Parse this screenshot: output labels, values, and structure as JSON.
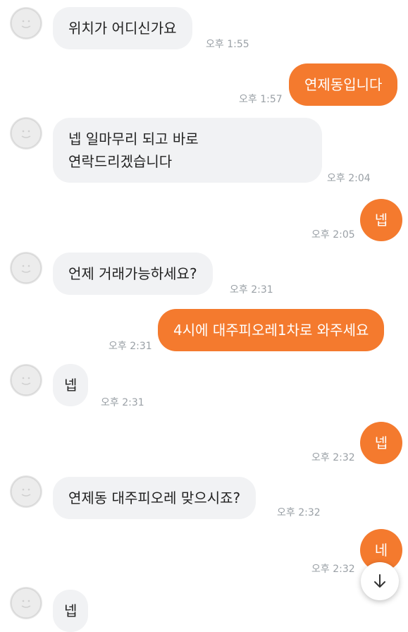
{
  "messages": [
    {
      "id": "m1",
      "side": "recv",
      "text": "위치가 어디신가요",
      "time": "오후 1:55"
    },
    {
      "id": "m2",
      "side": "sent",
      "text": "연제동입니다",
      "time": "오후 1:57"
    },
    {
      "id": "m3",
      "side": "recv",
      "line1": "넵 일마무리 되고 바로",
      "line2": "연락드리겠습니다",
      "time": "오후 2:04"
    },
    {
      "id": "m4",
      "side": "sent",
      "text": "넵",
      "time": "오후 2:05"
    },
    {
      "id": "m5",
      "side": "recv",
      "text": "언제 거래가능하세요?",
      "time": "오후 2:31"
    },
    {
      "id": "m6",
      "side": "sent",
      "text": "4시에 대주피오레1차로 와주세요",
      "time": "오후 2:31"
    },
    {
      "id": "m7",
      "side": "recv",
      "text": "넵",
      "time": "오후 2:31"
    },
    {
      "id": "m8",
      "side": "sent",
      "text": "넵",
      "time": "오후 2:32"
    },
    {
      "id": "m9",
      "side": "recv",
      "text": "연제동 대주피오레 맞으시죠?",
      "time": "오후 2:32"
    },
    {
      "id": "m10",
      "side": "sent",
      "text": "네",
      "time": "오후 2:32"
    },
    {
      "id": "m11",
      "side": "recv",
      "text": "넵",
      "time": ""
    }
  ],
  "icons": {
    "avatar": "default-profile-avatar-icon",
    "scroll": "arrow-down-icon"
  },
  "colors": {
    "sent_bubble": "#f47a2e",
    "recv_bubble": "#f1f2f4",
    "time_text": "#9aa0a6"
  }
}
